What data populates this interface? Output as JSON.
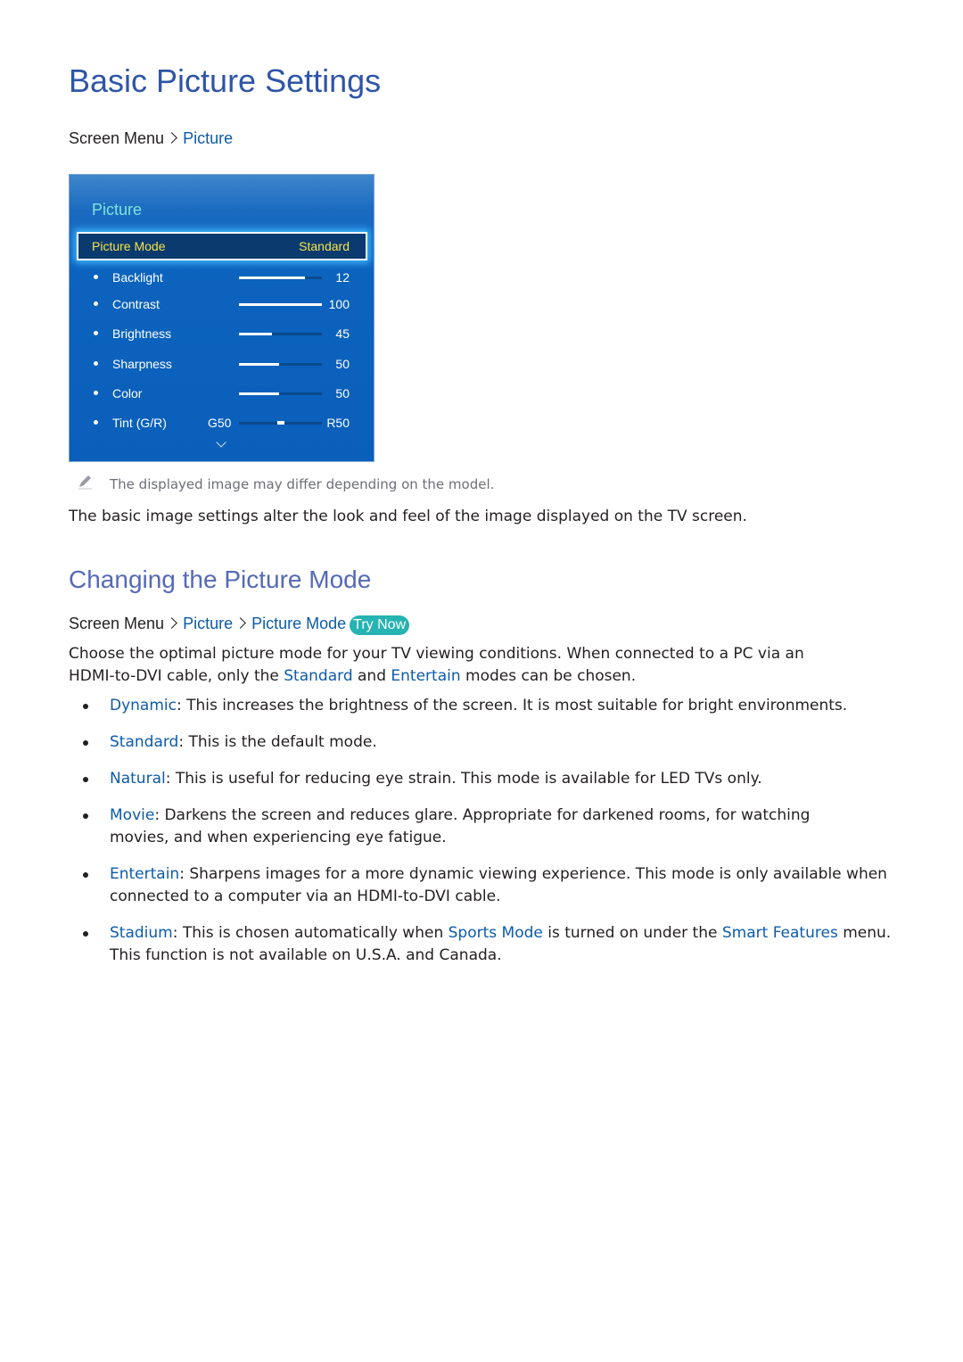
{
  "page": {
    "title": "Basic Picture Settings",
    "breadcrumb1": {
      "prefix": "Screen Menu",
      "items": [
        "Picture"
      ]
    },
    "tv_menu": {
      "title": "Picture",
      "selected": {
        "label": "Picture Mode",
        "value": "Standard"
      },
      "rows": [
        {
          "label": "Backlight",
          "value": "12",
          "fill": 0.8
        },
        {
          "label": "Contrast",
          "value": "100",
          "fill": 1.0
        },
        {
          "label": "Brightness",
          "value": "45",
          "fill": 0.4
        },
        {
          "label": "Sharpness",
          "value": "50",
          "fill": 0.48
        },
        {
          "label": "Color",
          "value": "50",
          "fill": 0.48
        }
      ],
      "tint": {
        "label": "Tint (G/R)",
        "left": "G50",
        "right": "R50",
        "position": 0.5
      },
      "more_icon": "chevron-down-icon"
    },
    "note": {
      "icon": "pencil-icon",
      "text": "The displayed image may differ depending on the model."
    },
    "intro": "The basic image settings alter the look and feel of the image displayed on the TV screen.",
    "section": {
      "title": "Changing the Picture Mode",
      "breadcrumb": {
        "prefix": "Screen Menu",
        "items": [
          "Picture",
          "Picture Mode"
        ],
        "try_now": "Try Now"
      },
      "para": {
        "p1": "Choose the optimal picture mode for your TV viewing conditions. When connected to a PC via an",
        "p2a": "HDMI-to-DVI cable, only the ",
        "p2b": "Standard",
        "p2c": " and ",
        "p2d": "Entertain",
        "p2e": " modes can be chosen."
      },
      "modes": [
        {
          "name": "Dynamic",
          "text": ": This increases the brightness of the screen. It is most suitable for bright environments."
        },
        {
          "name": "Standard",
          "text": ": This is the default mode."
        },
        {
          "name": "Natural",
          "text": ": This is useful for reducing eye strain. This mode is available for LED TVs only."
        },
        {
          "name": "Movie",
          "text": ": Darkens the screen and reduces glare. Appropriate for darkened rooms, for watching movies, and when experiencing eye fatigue."
        },
        {
          "name": "Entertain",
          "text": ": Sharpens images for a more dynamic viewing experience. This mode is only available when connected to a computer via an HDMI-to-DVI cable."
        },
        {
          "name": "Stadium",
          "text1": ": This is chosen automatically when ",
          "link1": "Sports Mode",
          "text2": " is turned on under the ",
          "link2": "Smart Features",
          "text3": " menu. This function is not available on U.S.A. and Canada."
        }
      ]
    }
  }
}
